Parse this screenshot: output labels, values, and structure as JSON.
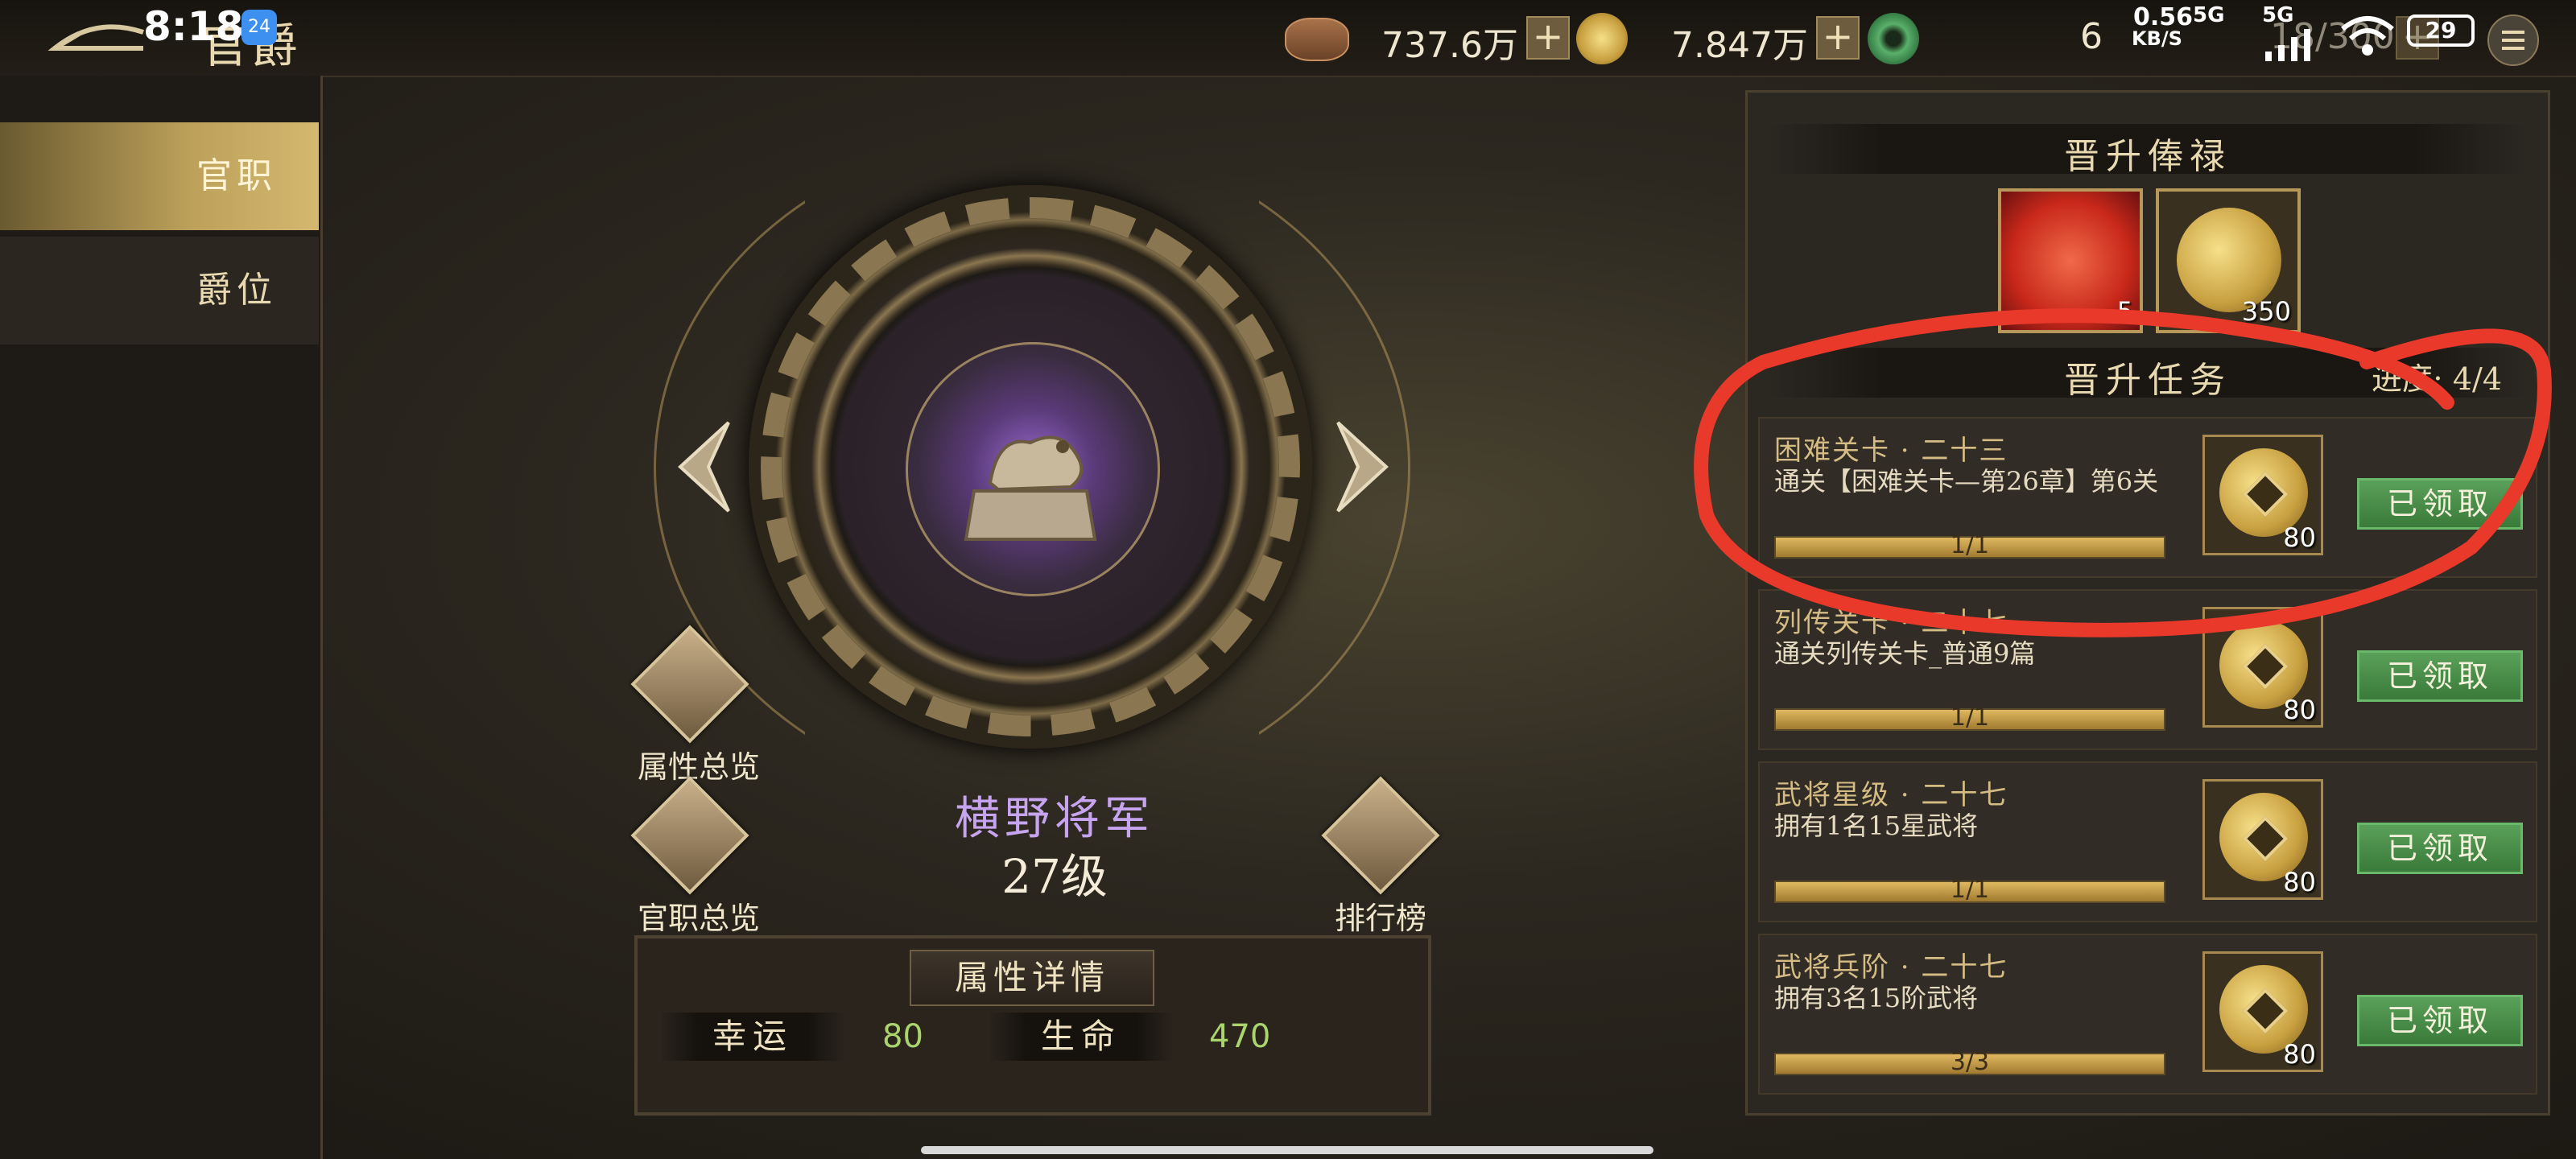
{
  "status_bar": {
    "time": "8:18",
    "notif_count": "24",
    "net_speed": "0.56",
    "net_unit": "KB/S",
    "sig1": "5G",
    "sig2": "5G",
    "battery": "29"
  },
  "header": {
    "title": "官爵"
  },
  "resources": [
    {
      "icon": "copper-coins-icon",
      "value": "737.6万"
    },
    {
      "icon": "gold-coin-icon",
      "value": "7.847万"
    },
    {
      "icon": "jade-icon",
      "value": "6"
    },
    {
      "icon": "stamina-icon",
      "value": "18/300"
    }
  ],
  "sidebar": {
    "tabs": [
      {
        "label": "官职",
        "active": true
      },
      {
        "label": "爵位",
        "active": false
      }
    ]
  },
  "side_buttons": {
    "attr_overview": "属性总览",
    "rank_overview": "官职总览",
    "leaderboard": "排行榜"
  },
  "rank": {
    "name": "横野将军",
    "level": "27级"
  },
  "attributes": {
    "title": "属性详情",
    "items": [
      {
        "label": "幸运",
        "value": "80"
      },
      {
        "label": "生命",
        "value": "470"
      }
    ]
  },
  "promotion": {
    "salary_title": "晋升俸禄",
    "rewards": [
      {
        "icon": "red-orb-icon",
        "qty": "5"
      },
      {
        "icon": "gold-coin-icon",
        "qty": "350"
      }
    ],
    "task_title": "晋升任务",
    "progress_label": "进度: 4/4",
    "tasks": [
      {
        "name": "困难关卡 · 二十三",
        "desc": "通关【困难关卡—第26章】第6关",
        "progress": "1/1",
        "reward_qty": "80",
        "button": "已领取"
      },
      {
        "name": "列传关卡 · 二十七",
        "desc": "通关列传关卡_普通9篇",
        "progress": "1/1",
        "reward_qty": "80",
        "button": "已领取"
      },
      {
        "name": "武将星级 · 二十七",
        "desc": "拥有1名15星武将",
        "progress": "1/1",
        "reward_qty": "80",
        "button": "已领取"
      },
      {
        "name": "武将兵阶 · 二十七",
        "desc": "拥有3名15阶武将",
        "progress": "3/3",
        "reward_qty": "80",
        "button": "已领取"
      }
    ]
  },
  "colors": {
    "annotation": "#e8392a",
    "rank_name": "#c7a4f0",
    "attr_value": "#a9d46e",
    "claim_button": "#4a8e4a"
  }
}
